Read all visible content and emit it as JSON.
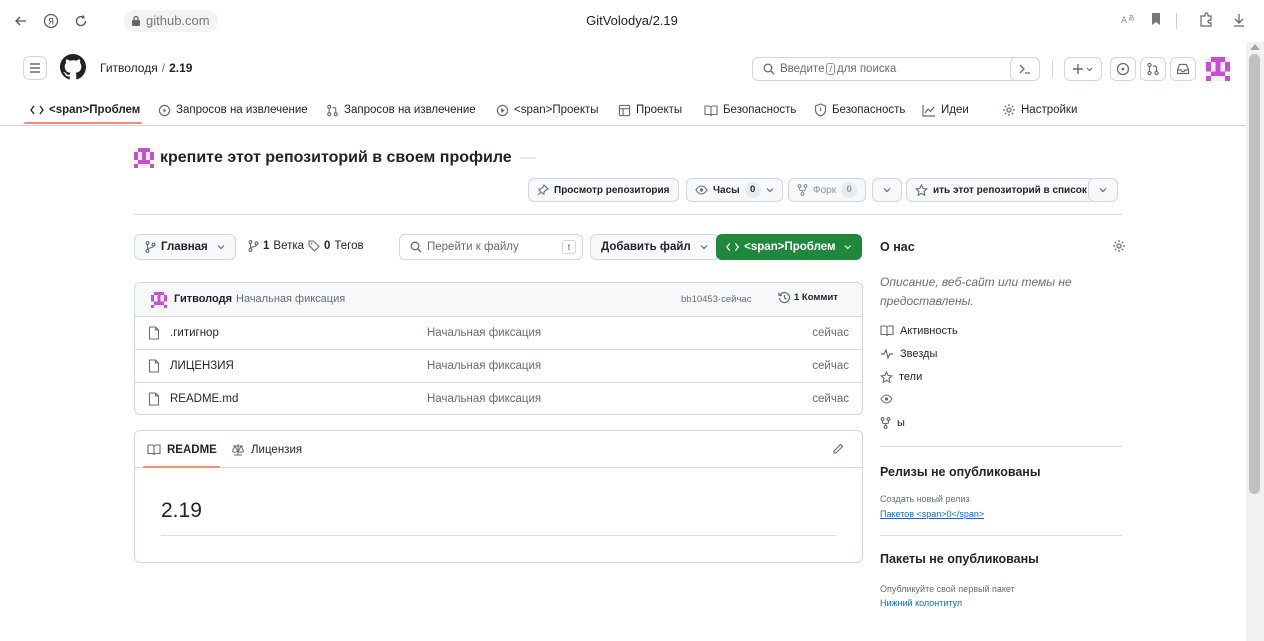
{
  "browser": {
    "url": "github.com",
    "tab_title": "GitVolodya/2.19"
  },
  "header": {
    "owner": "Гитволодя",
    "separator": "/",
    "repo": "2.19",
    "search_prefix": "Введите",
    "search_key": "/",
    "search_suffix": "для поиска"
  },
  "repo_nav": {
    "items": [
      {
        "label": "<span>Проблем",
        "icon": "code-icon"
      },
      {
        "label": "Запросов на извлечение",
        "icon": "issue-icon"
      },
      {
        "label": "Запросов на извлечение",
        "icon": "pull-request-icon"
      },
      {
        "label": "<span>Проекты",
        "icon": "play-icon"
      },
      {
        "label": "Проекты",
        "icon": "table-icon"
      },
      {
        "label": "Безопасность",
        "icon": "book-icon"
      },
      {
        "label": "Безопасность",
        "icon": "shield-icon"
      },
      {
        "label": "Идеи",
        "icon": "graph-icon"
      },
      {
        "label": "Настройки",
        "icon": "gear-icon"
      }
    ]
  },
  "repo_title": "крепите этот репозиторий в своем профиле",
  "actions": {
    "view_repo": "Просмотр репозитория",
    "watch_label": "Часы",
    "watch_count": "0",
    "fork_label": "Форк",
    "fork_count": "0",
    "star_label": "ить этот репозиторий в список"
  },
  "toolbar": {
    "branch": "Главная",
    "branches_count": "1",
    "branches_label": "Ветка",
    "tags_count": "0",
    "tags_label": "Тегов",
    "goto_placeholder": "Перейти к файлу",
    "goto_key": "t",
    "add_file": "Добавить файл",
    "code_button": "<span>Проблем"
  },
  "latest_commit": {
    "author": "Гитволодя",
    "message": "Начальная фиксация",
    "hash_time": "bb10453·сейчас",
    "commits": "1 Коммит"
  },
  "files": [
    {
      "name": ".гитигнор",
      "message": "Начальная фиксация",
      "time": "сейчас"
    },
    {
      "name": "ЛИЦЕНЗИЯ",
      "message": "Начальная фиксация",
      "time": "сейчас"
    },
    {
      "name": "README.md",
      "message": "Начальная фиксация",
      "time": "сейчас"
    }
  ],
  "readme": {
    "tab_readme": "README",
    "tab_license": "Лицензия",
    "heading": "2.19"
  },
  "sidebar": {
    "about_title": "О нас",
    "about_desc": "Описание, веб-сайт или темы не предоставлены.",
    "links": [
      {
        "label": "Активность",
        "icon": "book-icon"
      },
      {
        "label": "Звезды",
        "icon": "pulse-icon"
      },
      {
        "label": "тели",
        "icon": "star-icon"
      },
      {
        "label": "",
        "icon": "eye-icon"
      },
      {
        "label": "ы",
        "icon": "fork-icon"
      }
    ],
    "releases_title": "Релизы не опубликованы",
    "releases_create": "Создать новый релиз",
    "packages_link": "Пакетов <span>0</span>",
    "packages_title": "Пакеты не опубликованы",
    "packages_desc": "Опубликуйте свой первый пакет",
    "footer_link": "Нижний колонтитул"
  }
}
